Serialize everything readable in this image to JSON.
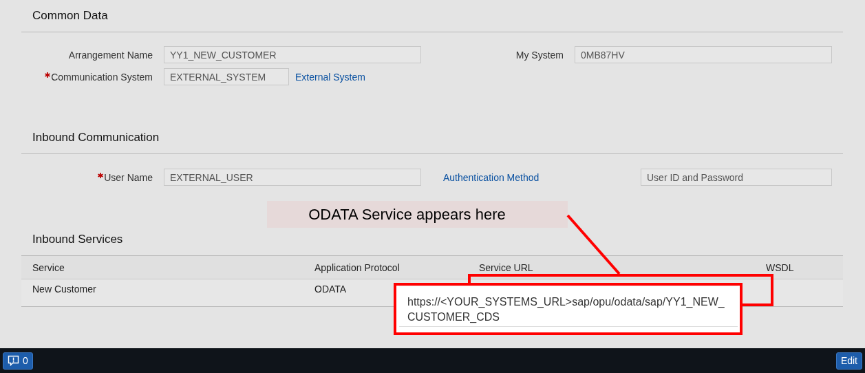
{
  "common_data": {
    "title": "Common Data",
    "fields": [
      {
        "label": "Arrangement Name",
        "required": false,
        "value": "YY1_NEW_CUSTOMER"
      },
      {
        "label": "Communication System",
        "required": true,
        "value": "EXTERNAL_SYSTEM",
        "link": "External System"
      },
      {
        "label": "My System",
        "required": false,
        "value": "0MB87HV"
      }
    ]
  },
  "inbound_communication": {
    "title": "Inbound Communication",
    "fields": [
      {
        "label": "User Name",
        "required": true,
        "value": "EXTERNAL_USER"
      },
      {
        "link": "Authentication Method",
        "value": "User ID and Password"
      }
    ]
  },
  "inbound_services": {
    "title": "Inbound Services",
    "columns": [
      "Service",
      "Application Protocol",
      "Service URL",
      "WSDL"
    ],
    "rows": [
      {
        "cells": [
          "New Customer",
          "ODATA"
        ]
      }
    ]
  },
  "annotation": {
    "callout": "ODATA Service appears here",
    "popup_text": "https://<YOUR_SYSTEMS_URL>sap/opu/odata/sap/YY1_NEW_CUSTOMER_CDS"
  },
  "footer": {
    "message_count": "0",
    "edit_button": "Edit"
  }
}
